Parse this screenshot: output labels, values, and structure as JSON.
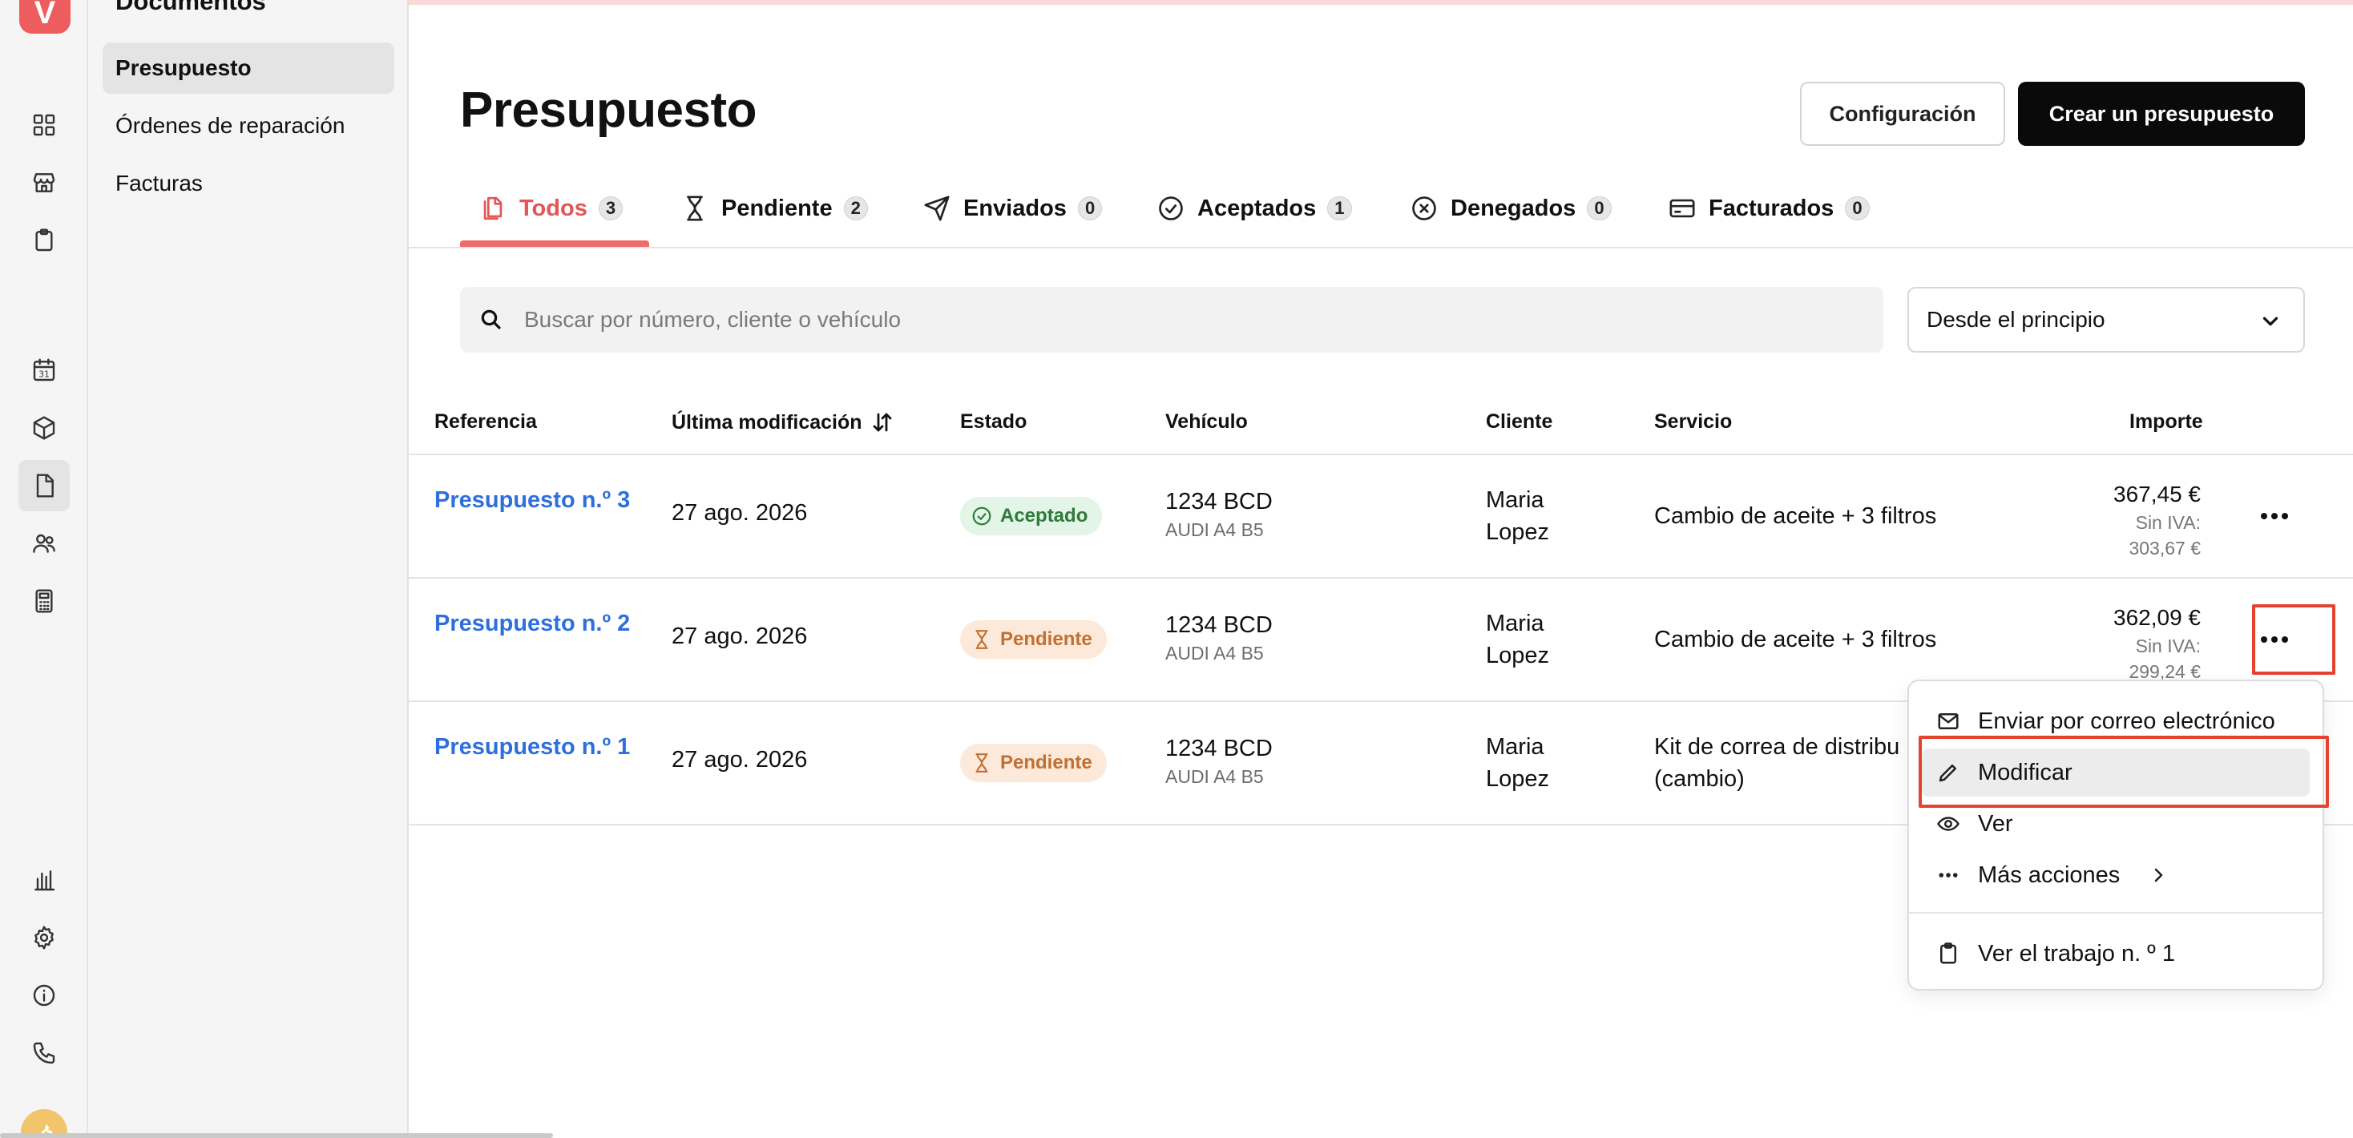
{
  "app": {
    "logo_letter": "V",
    "brand_color": "#ee5d5d"
  },
  "rail": {
    "icons": [
      "dashboard-icon",
      "shop-icon",
      "clipboard-icon",
      "calendar-icon",
      "box-icon",
      "document-icon",
      "users-icon",
      "calculator-icon",
      "chart-icon",
      "gear-icon",
      "info-icon",
      "phone-icon",
      "wrench-icon"
    ],
    "calendar_day": "31"
  },
  "docs": {
    "title": "Documentos",
    "items": [
      {
        "label": "Presupuesto",
        "active": true
      },
      {
        "label": "Órdenes de reparación",
        "active": false
      },
      {
        "label": "Facturas",
        "active": false
      }
    ]
  },
  "header": {
    "title": "Presupuesto",
    "config_label": "Configuración",
    "create_label": "Crear un presupuesto"
  },
  "tabs": [
    {
      "label": "Todos",
      "count": "3",
      "icon": "documents-icon",
      "active": true
    },
    {
      "label": "Pendiente",
      "count": "2",
      "icon": "hourglass-icon",
      "active": false
    },
    {
      "label": "Enviados",
      "count": "0",
      "icon": "send-icon",
      "active": false
    },
    {
      "label": "Aceptados",
      "count": "1",
      "icon": "check-circle-icon",
      "active": false
    },
    {
      "label": "Denegados",
      "count": "0",
      "icon": "x-circle-icon",
      "active": false
    },
    {
      "label": "Facturados",
      "count": "0",
      "icon": "credit-card-icon",
      "active": false
    }
  ],
  "filters": {
    "search_placeholder": "Buscar por número, cliente o vehículo",
    "search_value": "",
    "period_value": "Desde el principio"
  },
  "table": {
    "columns": [
      "Referencia",
      "Última modificación",
      "Estado",
      "Vehículo",
      "Cliente",
      "Servicio",
      "Importe"
    ],
    "rows": [
      {
        "ref": "Presupuesto n.º 3",
        "date": "27 ago. 2026",
        "status": "Aceptado",
        "plate": "1234 BCD",
        "model": "AUDI A4 B5",
        "client": "Maria Lopez",
        "service": "Cambio de aceite + 3 filtros",
        "total": "367,45 €",
        "net": "Sin IVA: 303,67 €"
      },
      {
        "ref": "Presupuesto n.º 2",
        "date": "27 ago. 2026",
        "status": "Pendiente",
        "plate": "1234 BCD",
        "model": "AUDI A4 B5",
        "client": "Maria Lopez",
        "service": "Cambio de aceite + 3 filtros",
        "total": "362,09 €",
        "net": "Sin IVA: 299,24 €"
      },
      {
        "ref": "Presupuesto n.º 1",
        "date": "27 ago. 2026",
        "status": "Pendiente",
        "plate": "1234 BCD",
        "model": "AUDI A4 B5",
        "client": "Maria Lopez",
        "service": "Kit de correa de distribu (cambio)",
        "total": "",
        "net": ""
      }
    ]
  },
  "context_menu": {
    "items": [
      {
        "label": "Enviar por correo electrónico",
        "icon": "mail-icon"
      },
      {
        "label": "Modificar",
        "icon": "pencil-icon"
      },
      {
        "label": "Ver",
        "icon": "eye-icon"
      },
      {
        "label": "Más acciones",
        "icon": "ellipsis-icon"
      },
      {
        "label": "Ver el trabajo n. º 1",
        "icon": "clipboard-icon"
      }
    ]
  },
  "colors": {
    "accent": "#e45555",
    "link": "#2e6fde",
    "accepted_bg": "#e3f5e6",
    "accepted_fg": "#2f7a3b",
    "pending_bg": "#fde9d9",
    "pending_fg": "#c07032",
    "highlight": "#e3432f"
  }
}
